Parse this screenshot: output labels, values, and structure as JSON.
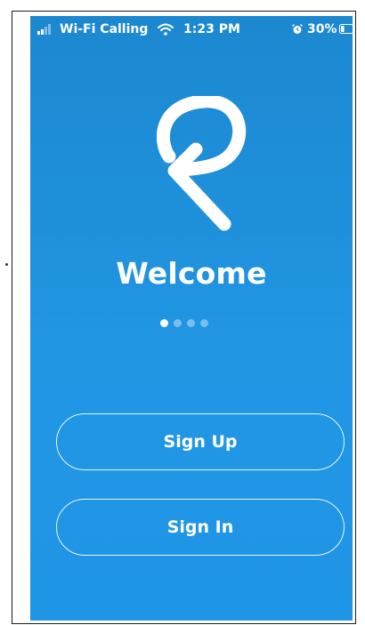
{
  "status_bar": {
    "carrier": "Wi-Fi Calling",
    "time": "1:23 PM",
    "battery": "30%",
    "icons": [
      "signal-icon",
      "wifi-icon",
      "alarm-icon",
      "battery-icon"
    ],
    "battery_level": 0.3
  },
  "welcome": {
    "logo_icon": "app-logo-icon",
    "title": "Welcome",
    "pager": {
      "count": 4,
      "active_index": 0
    }
  },
  "actions": {
    "sign_up_label": "Sign Up",
    "sign_in_label": "Sign In"
  },
  "colors": {
    "background_top": "#1c88d0",
    "background_bottom": "#1f95e6",
    "foreground": "#ffffff"
  }
}
